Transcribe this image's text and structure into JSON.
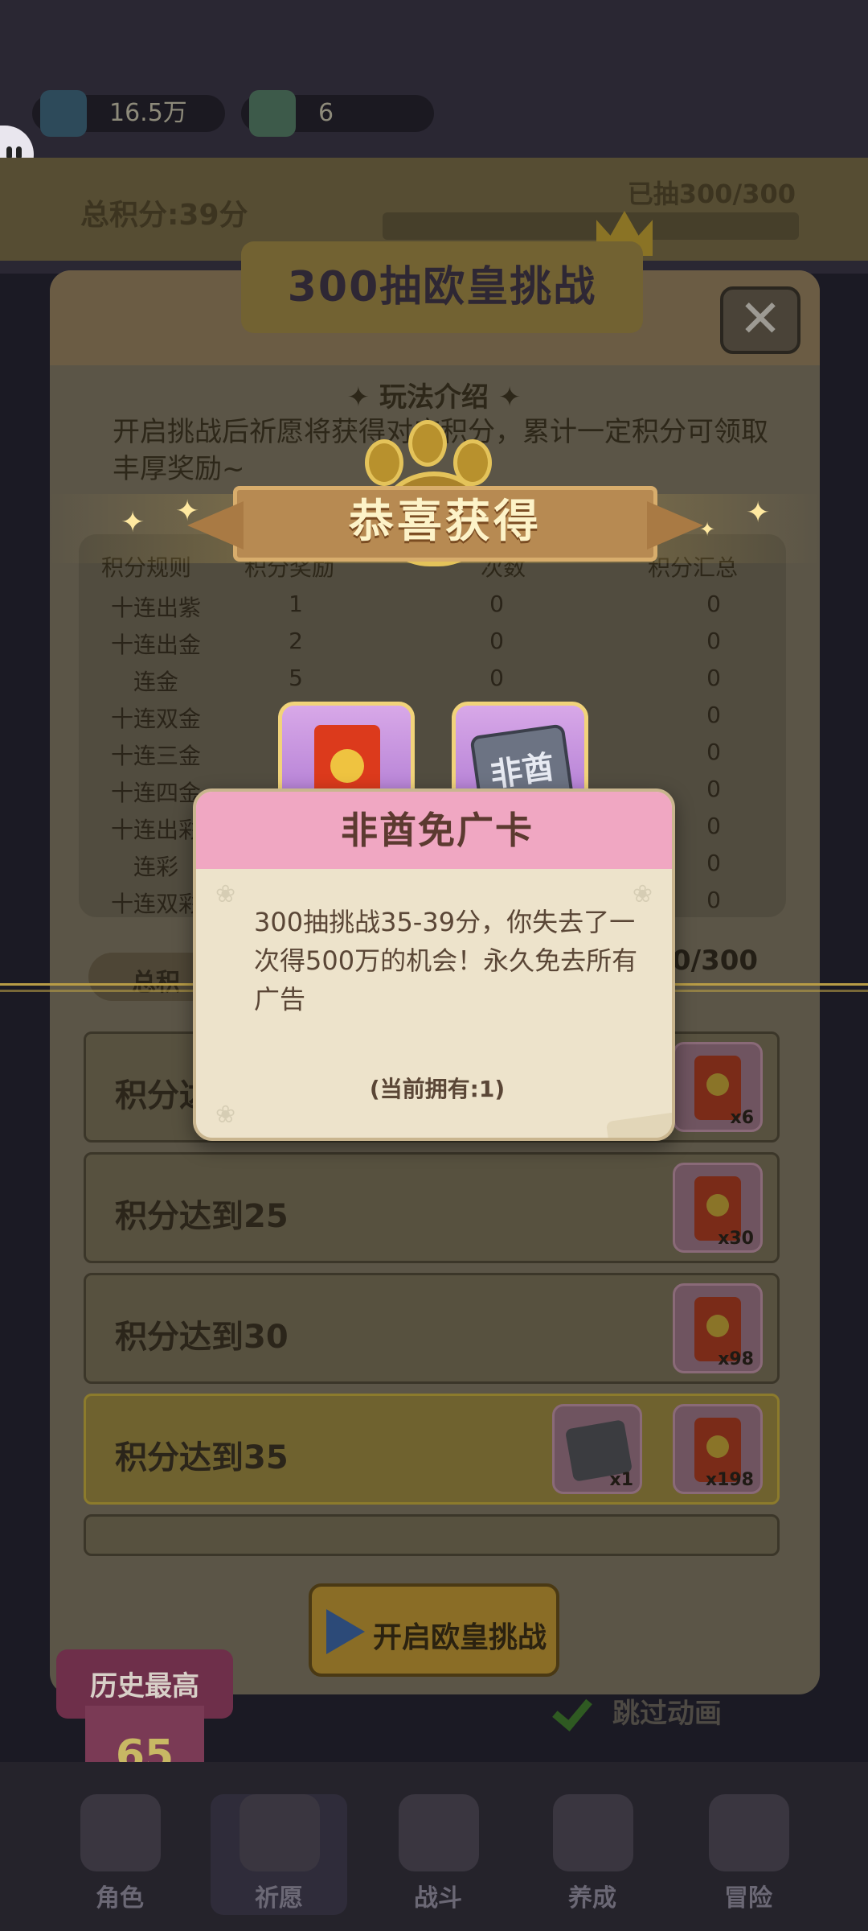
{
  "resources": [
    {
      "icon": "gem-icon",
      "value": "16.5万"
    },
    {
      "icon": "ticket-icon",
      "value": "6"
    }
  ],
  "score_bar": {
    "total": "总积分:39分",
    "drawn": "已抽300/300"
  },
  "challenge": {
    "title": "300抽欧皇挑战",
    "intro_title": "✦ 玩法介绍 ✦",
    "intro_text": "开启挑战后祈愿将获得对应积分，累计一定积分可领取丰厚奖励~",
    "table_headers": [
      "积分规则",
      "积分奖励",
      "次数",
      "积分汇总"
    ],
    "rules": [
      {
        "name": "十连出紫",
        "points": "1",
        "count": "0",
        "sum": "0"
      },
      {
        "name": "十连出金",
        "points": "2",
        "count": "0",
        "sum": "0"
      },
      {
        "name": "连金",
        "points": "5",
        "count": "0",
        "sum": "0"
      },
      {
        "name": "十连双金",
        "points": "",
        "count": "",
        "sum": "0"
      },
      {
        "name": "十连三金",
        "points": "",
        "count": "",
        "sum": "0"
      },
      {
        "name": "十连四金",
        "points": "",
        "count": "",
        "sum": "0"
      },
      {
        "name": "十连出彩",
        "points": "",
        "count": "",
        "sum": "0"
      },
      {
        "name": "连彩",
        "points": "",
        "count": "",
        "sum": "0"
      },
      {
        "name": "十连双彩",
        "points": "",
        "count": "",
        "sum": "0"
      }
    ],
    "total_label": "总积",
    "total_count": "0/300",
    "rewards": [
      {
        "label": "积分达",
        "items": [
          {
            "icon": "red-envelope-icon",
            "qty": "x6"
          }
        ]
      },
      {
        "label": "积分达到25",
        "items": [
          {
            "icon": "red-envelope-icon",
            "qty": "x30"
          }
        ]
      },
      {
        "label": "积分达到30",
        "items": [
          {
            "icon": "red-envelope-icon",
            "qty": "x98"
          }
        ]
      },
      {
        "label": "积分达到35",
        "items": [
          {
            "icon": "ad-free-card-icon",
            "qty": "x1"
          },
          {
            "icon": "red-envelope-icon",
            "qty": "x198"
          }
        ]
      }
    ],
    "start_button": "开启欧皇挑战"
  },
  "history": {
    "label": "历史最高",
    "value": "65"
  },
  "skip_label": "跳过动画",
  "nav": [
    {
      "label": "角色",
      "icon": "character-icon"
    },
    {
      "label": "祈愿",
      "icon": "wish-icon",
      "active": true
    },
    {
      "label": "战斗",
      "icon": "battle-icon"
    },
    {
      "label": "养成",
      "icon": "growth-icon"
    },
    {
      "label": "冒险",
      "icon": "adventure-icon"
    }
  ],
  "congrats": {
    "title": "恭喜获得",
    "cards": [
      {
        "icon": "red-envelope-icon"
      },
      {
        "icon": "ad-free-card-icon",
        "text": "非酋"
      }
    ]
  },
  "popup": {
    "title": "非酋免广卡",
    "description": "300抽挑战35-39分，你失去了一次得500万的机会！永久免去所有广告",
    "owned": "(当前拥有:1)"
  },
  "colors": {
    "popup_header": "#f0a7c2",
    "popup_body": "#ede3cb",
    "gold": "#e4c35a"
  }
}
